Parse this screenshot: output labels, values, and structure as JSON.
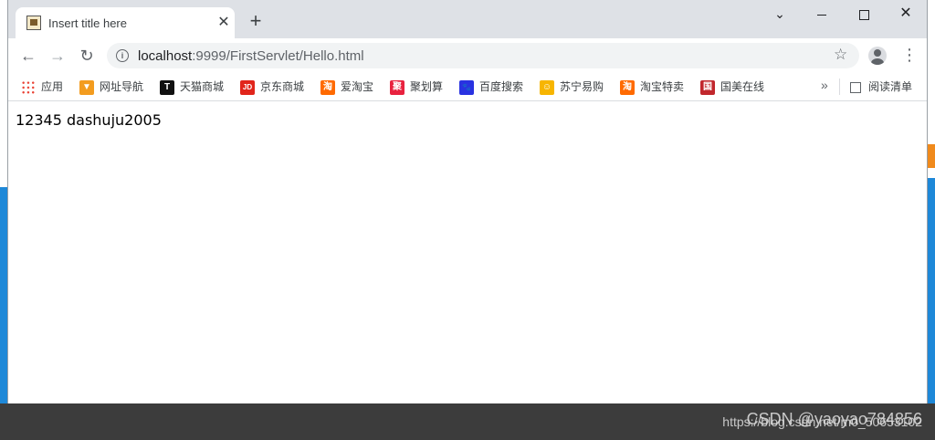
{
  "tab": {
    "title": "Insert title here"
  },
  "toolbar": {
    "url_host": "localhost",
    "url_rest": ":9999/FirstServlet/Hello.html"
  },
  "bookmarks": [
    {
      "label": "应用",
      "icon": "apps-grid-icon",
      "color": "#ea4335",
      "glyph": ""
    },
    {
      "label": "网址导航",
      "icon": "nav-down-arrow-icon",
      "color": "#f39c1f",
      "glyph": "▼"
    },
    {
      "label": "天猫商城",
      "icon": "tmall-icon",
      "color": "#111111",
      "glyph": "T"
    },
    {
      "label": "京东商城",
      "icon": "jd-icon",
      "color": "#e1251b",
      "glyph": "JD"
    },
    {
      "label": "爱淘宝",
      "icon": "taobao-icon",
      "color": "#ff6a00",
      "glyph": "淘"
    },
    {
      "label": "聚划算",
      "icon": "juhuasuan-icon",
      "color": "#e8223f",
      "glyph": "聚"
    },
    {
      "label": "百度搜索",
      "icon": "baidu-paw-icon",
      "color": "#2932e1",
      "glyph": "🐾"
    },
    {
      "label": "苏宁易购",
      "icon": "suning-icon",
      "color": "#f7b500",
      "glyph": "☺"
    },
    {
      "label": "淘宝特卖",
      "icon": "taobao-sale-icon",
      "color": "#ff6a00",
      "glyph": "淘"
    },
    {
      "label": "国美在线",
      "icon": "gome-icon",
      "color": "#c1272d",
      "glyph": "国"
    }
  ],
  "reading_list": "阅读清单",
  "page": {
    "text": "12345 dashuju2005"
  },
  "watermark": {
    "csdn": "CSDN @yaoyao784856",
    "url": "https://blog.csdn.net/m0_50653102"
  }
}
